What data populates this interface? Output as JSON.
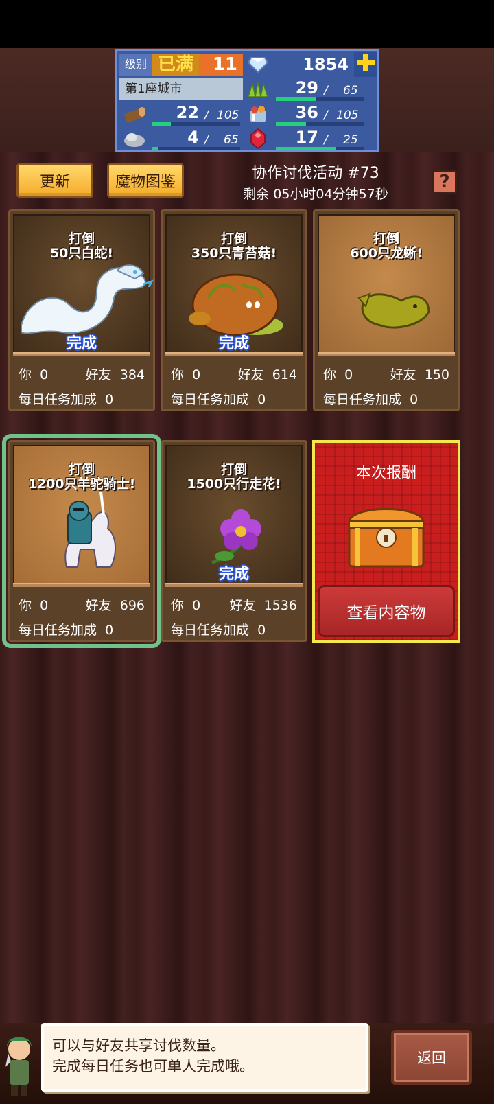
{
  "status": {
    "level_label": "级别",
    "level_max": "已满",
    "level_value": "11",
    "gems": "1854",
    "city_name": "第1座城市",
    "resources": [
      {
        "name": "wood",
        "icon": "wood-icon",
        "value": "22",
        "max": "105",
        "fill": 0.21
      },
      {
        "name": "stone",
        "icon": "stone-icon",
        "value": "4",
        "max": "65",
        "fill": 0.06
      },
      {
        "name": "grass",
        "icon": "grass-icon",
        "value": "29",
        "max": "65",
        "fill": 0.45
      },
      {
        "name": "food",
        "icon": "food-icon",
        "value": "36",
        "max": "105",
        "fill": 0.34
      },
      {
        "name": "ruby",
        "icon": "ruby-icon",
        "value": "17",
        "max": "25",
        "fill": 0.68
      }
    ],
    "separator": "/"
  },
  "buttons": {
    "refresh": "更新",
    "monster_book": "魔物图鉴",
    "help": "?"
  },
  "event": {
    "title": "协作讨伐活动 #73",
    "timer": "剩余 05小时04分钟57秒"
  },
  "common": {
    "defeat": "打倒",
    "you_label": "你",
    "friends_label": "好友",
    "daily_bonus_label": "每日任务加成",
    "done_label": "完成"
  },
  "cards": [
    {
      "target": "50只白蛇!",
      "you": "0",
      "friends": "384",
      "daily": "0",
      "completed": true,
      "monster": "white-snake"
    },
    {
      "target": "350只青苔菇!",
      "you": "0",
      "friends": "614",
      "daily": "0",
      "completed": true,
      "monster": "moss-mushroom"
    },
    {
      "target": "600只龙蜥!",
      "you": "0",
      "friends": "150",
      "daily": "0",
      "completed": false,
      "monster": "dragon-lizard"
    },
    {
      "target": "1200只羊驼骑士!",
      "you": "0",
      "friends": "696",
      "daily": "0",
      "completed": false,
      "monster": "alpaca-knight"
    },
    {
      "target": "1500只行走花!",
      "you": "0",
      "friends": "1536",
      "daily": "0",
      "completed": true,
      "monster": "walking-flower"
    }
  ],
  "reward": {
    "title": "本次报酬",
    "button": "查看内容物"
  },
  "tip": {
    "line1": "可以与好友共享讨伐数量。",
    "line2": "完成每日任务也可单人完成哦。"
  },
  "back": "返回",
  "colors": {
    "accent_yellow": "#f4ac2c",
    "bar_green": "#24d07c",
    "done_blue": "#2c57d6",
    "reward_red": "#c81e1e"
  }
}
